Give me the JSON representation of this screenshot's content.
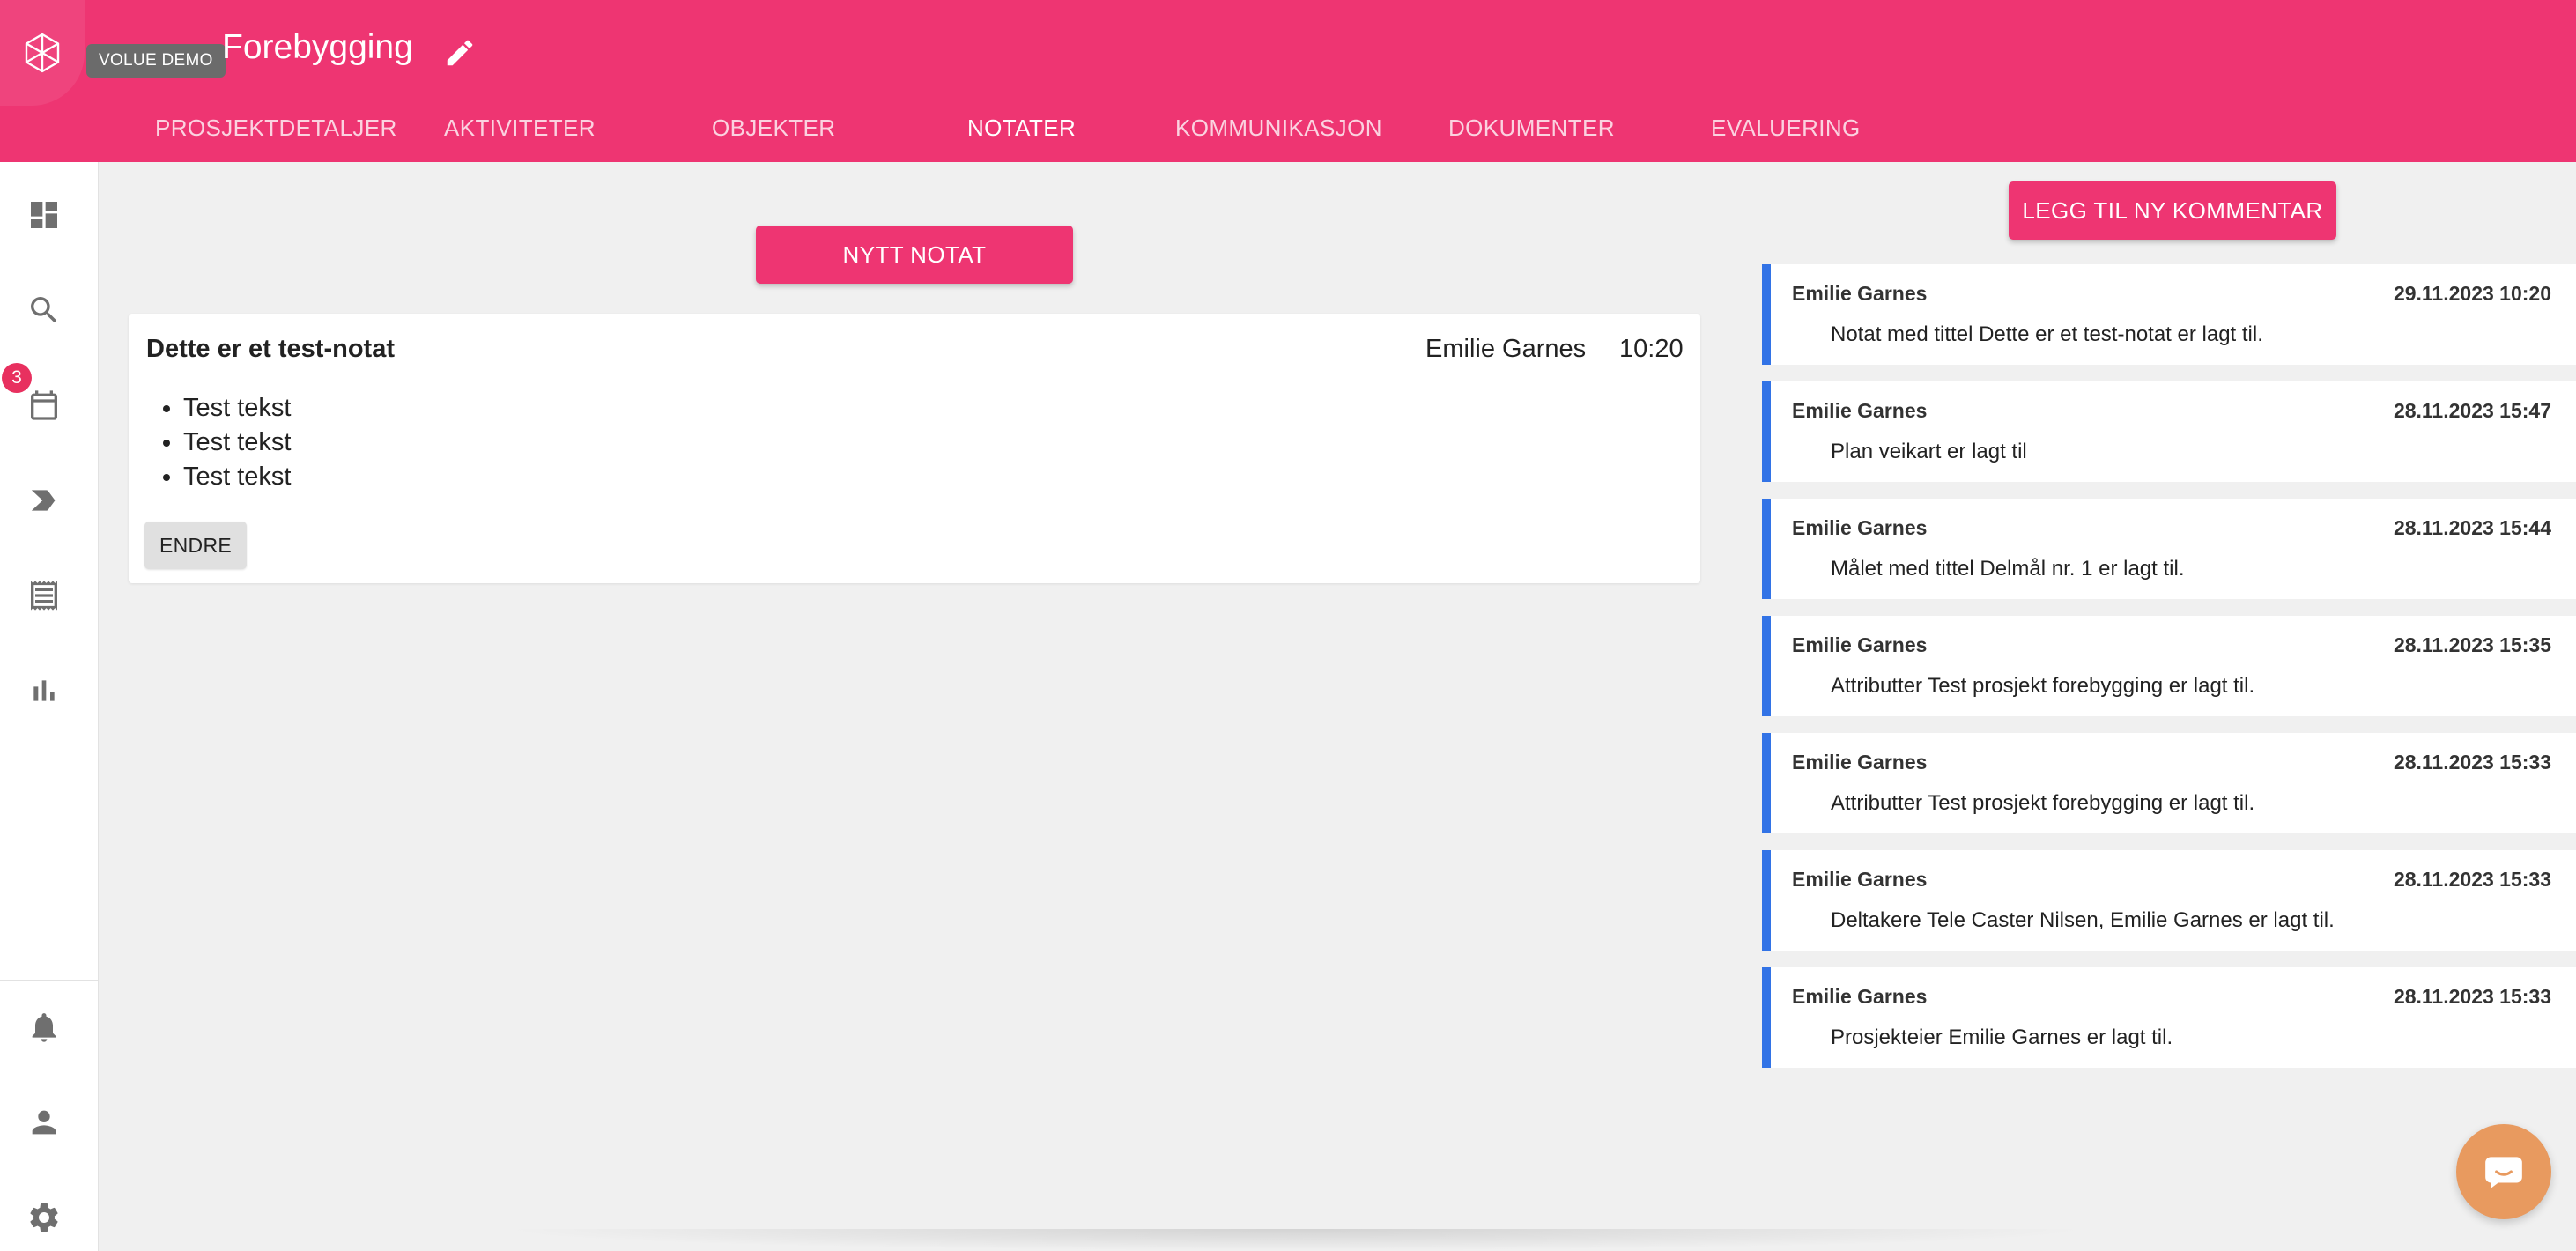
{
  "header": {
    "logo_tooltip": "VOLUE DEMO",
    "project_title": "Forebygging",
    "tabs": [
      {
        "label": "PROSJEKTDETALJER"
      },
      {
        "label": "AKTIVITETER"
      },
      {
        "label": "OBJEKTER"
      },
      {
        "label": "NOTATER"
      },
      {
        "label": "KOMMUNIKASJON"
      },
      {
        "label": "DOKUMENTER"
      },
      {
        "label": "EVALUERING"
      }
    ],
    "active_tab": "NOTATER"
  },
  "sidebar": {
    "items": [
      {
        "icon": "dashboard-icon"
      },
      {
        "icon": "search-icon"
      },
      {
        "icon": "calendar-icon",
        "badge": "3"
      },
      {
        "icon": "label-icon"
      },
      {
        "icon": "receipt-icon"
      },
      {
        "icon": "bar-chart-icon"
      }
    ],
    "bottom_items": [
      {
        "icon": "bell-icon"
      },
      {
        "icon": "person-icon"
      },
      {
        "icon": "gear-icon"
      }
    ]
  },
  "notes": {
    "new_note_label": "NYTT NOTAT",
    "items": [
      {
        "title": "Dette er et test-notat",
        "author": "Emilie Garnes",
        "time": "10:20",
        "bullets": [
          "Test tekst",
          "Test tekst",
          "Test tekst"
        ],
        "edit_label": "ENDRE"
      }
    ]
  },
  "comments": {
    "add_label": "LEGG TIL NY KOMMENTAR",
    "accent_color": "#3273e6",
    "items": [
      {
        "author": "Emilie Garnes",
        "date": "29.11.2023 10:20",
        "text": "Notat med tittel Dette er et test-notat er lagt til."
      },
      {
        "author": "Emilie Garnes",
        "date": "28.11.2023 15:47",
        "text": "Plan veikart er lagt til"
      },
      {
        "author": "Emilie Garnes",
        "date": "28.11.2023 15:44",
        "text": "Målet med tittel Delmål nr. 1 er lagt til."
      },
      {
        "author": "Emilie Garnes",
        "date": "28.11.2023 15:35",
        "text": "Attributter Test prosjekt forebygging er lagt til."
      },
      {
        "author": "Emilie Garnes",
        "date": "28.11.2023 15:33",
        "text": "Attributter Test prosjekt forebygging er lagt til."
      },
      {
        "author": "Emilie Garnes",
        "date": "28.11.2023 15:33",
        "text": "Deltakere Tele Caster Nilsen, Emilie Garnes er lagt til."
      },
      {
        "author": "Emilie Garnes",
        "date": "28.11.2023 15:33",
        "text": "Prosjekteier Emilie Garnes er lagt til."
      }
    ]
  },
  "theme": {
    "brand_color": "#ee3572",
    "chat_color": "#e89a5f"
  }
}
